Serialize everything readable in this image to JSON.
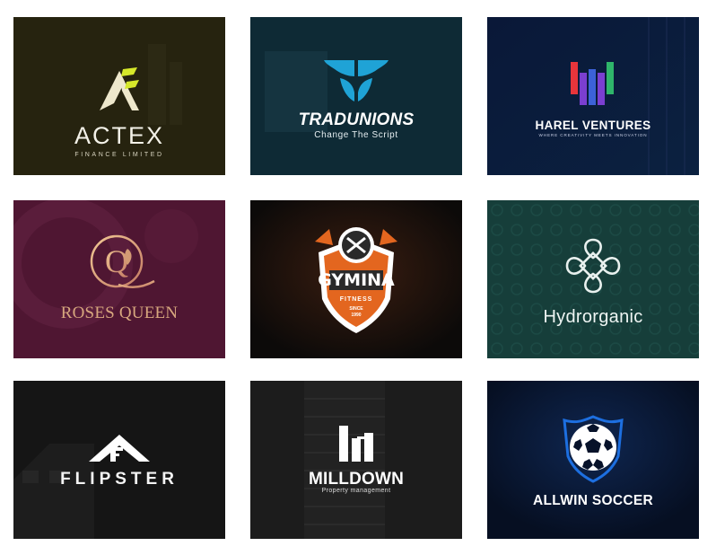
{
  "gallery": {
    "tiles": [
      {
        "brand": "ACTEX",
        "tagline": "FINANCE LIMITED",
        "background": "#26230f",
        "accent": "#eee8cc",
        "icon": "actex-a-icon"
      },
      {
        "brand": "TRADUNIONS",
        "tagline": "Change The Script",
        "background": "#0e2a35",
        "accent": "#1fa3d6",
        "icon": "tradunions-wings-icon"
      },
      {
        "brand": "HAREL VENTURES",
        "tagline": "WHERE CREATIVITY MEETS INNOVATION",
        "background": "#0c1a40",
        "accent": "#7b3fd0",
        "icon": "harel-bars-icon"
      },
      {
        "brand": "ROSES QUEEN",
        "background": "#4f1632",
        "accent": "#d7a77e",
        "icon": "roses-queen-q-icon"
      },
      {
        "brand": "GYMINA",
        "badge_text": "FITNESS",
        "since_text": "SINCE",
        "year_text": "1990",
        "background": "#0c0a09",
        "accent": "#e3661f",
        "icon": "gym-shield-icon"
      },
      {
        "brand": "Hydrorganic",
        "background": "#163e3a",
        "accent": "#e8f0ee",
        "icon": "celtic-knot-icon"
      },
      {
        "brand": "FLIPSTER",
        "background": "#151515",
        "accent": "#ffffff",
        "icon": "flipster-roof-icon"
      },
      {
        "brand": "MILLDOWN",
        "tagline": "Property management",
        "background": "#1c1c1c",
        "accent": "#ffffff",
        "icon": "building-icon"
      },
      {
        "brand": "ALLWIN SOCCER",
        "background": "#07122a",
        "accent": "#1d6fe0",
        "icon": "soccer-shield-icon"
      }
    ]
  }
}
